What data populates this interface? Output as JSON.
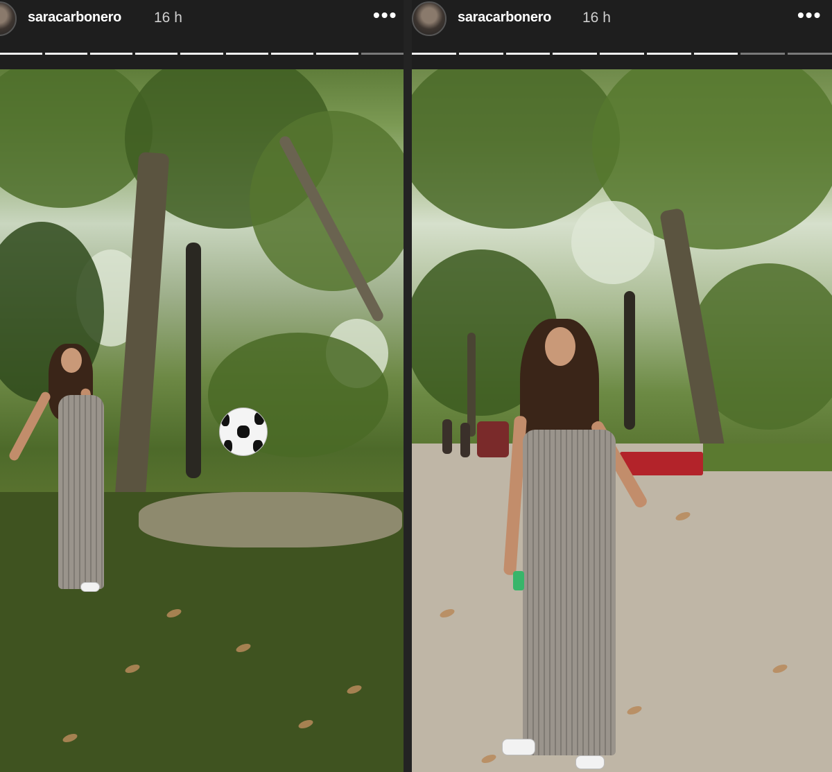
{
  "stories": [
    {
      "username": "saracarbonero",
      "time": "16 h",
      "more_icon": "more-horizontal-icon",
      "progress": {
        "segments": 9,
        "completed": 8
      }
    },
    {
      "username": "saracarbonero",
      "time": "16 h",
      "more_icon": "more-horizontal-icon",
      "progress": {
        "segments": 9,
        "completed": 7
      }
    }
  ],
  "more_glyph": "•••"
}
